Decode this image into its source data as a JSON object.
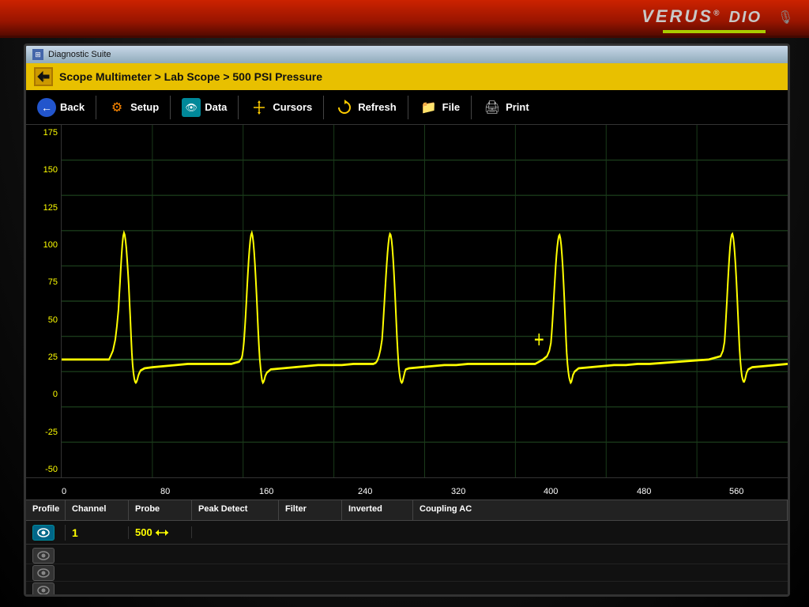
{
  "device": {
    "brand": "VERUS",
    "trademark": "®",
    "model": "DIO"
  },
  "window": {
    "title": "Diagnostic Suite"
  },
  "breadcrumb": {
    "text": "Scope Multimeter > Lab Scope > 500 PSI Pressure"
  },
  "toolbar": {
    "back_label": "Back",
    "setup_label": "Setup",
    "data_label": "Data",
    "cursors_label": "Cursors",
    "refresh_label": "Refresh",
    "file_label": "File",
    "print_label": "Print"
  },
  "y_axis": {
    "labels": [
      "175",
      "150",
      "125",
      "100",
      "75",
      "50",
      "25",
      "0",
      "-25",
      "-50"
    ]
  },
  "x_axis": {
    "labels": [
      {
        "value": "0",
        "pos": 0
      },
      {
        "value": "80",
        "pos": 14
      },
      {
        "value": "160",
        "pos": 27
      },
      {
        "value": "240",
        "pos": 41
      },
      {
        "value": "320",
        "pos": 55
      },
      {
        "value": "400",
        "pos": 68
      },
      {
        "value": "480",
        "pos": 82
      },
      {
        "value": "560",
        "pos": 95
      }
    ]
  },
  "data_table": {
    "columns": [
      "Profile",
      "Channel",
      "Probe",
      "Peak Detect",
      "Filter",
      "Inverted",
      "Coupling AC"
    ],
    "rows": [
      {
        "profile_icon": "eye",
        "channel": "1",
        "probe": "500",
        "peak_detect": "",
        "filter": "",
        "inverted": "",
        "coupling": ""
      },
      {
        "profile_icon": "eye_inactive",
        "channel": "",
        "probe": "",
        "peak_detect": "",
        "filter": "",
        "inverted": "",
        "coupling": ""
      },
      {
        "profile_icon": "eye_inactive",
        "channel": "",
        "probe": "",
        "peak_detect": "",
        "filter": "",
        "inverted": "",
        "coupling": ""
      },
      {
        "profile_icon": "eye_inactive",
        "channel": "",
        "probe": "",
        "peak_detect": "",
        "filter": "",
        "inverted": "",
        "coupling": ""
      }
    ]
  },
  "scope": {
    "crosshair_visible": true
  }
}
